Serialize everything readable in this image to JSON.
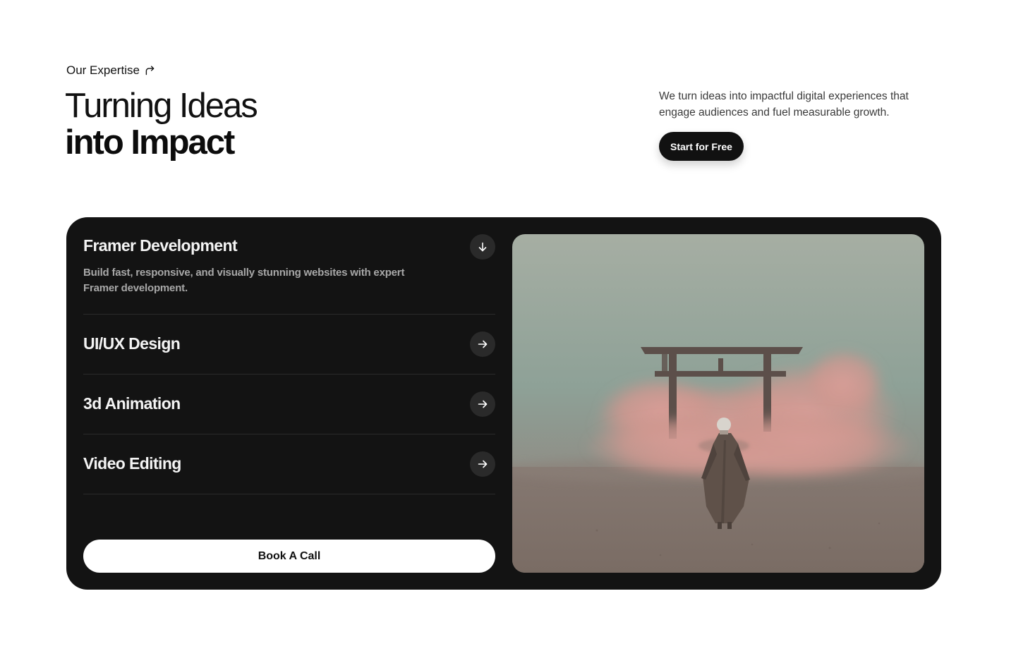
{
  "header": {
    "eyebrow": "Our Expertise",
    "headline_light": "Turning Ideas",
    "headline_bold": "into Impact",
    "intro": "We turn ideas into impactful digital experiences that engage audiences and fuel measurable growth.",
    "cta_label": "Start for Free"
  },
  "services": [
    {
      "title": "Framer Development",
      "description": "Build fast, responsive, and visually stunning websites with expert Framer development.",
      "expanded": true,
      "icon": "arrow-down-icon"
    },
    {
      "title": "UI/UX Design",
      "expanded": false,
      "icon": "arrow-right-icon"
    },
    {
      "title": "3d Animation",
      "expanded": false,
      "icon": "arrow-right-icon"
    },
    {
      "title": "Video Editing",
      "expanded": false,
      "icon": "arrow-right-icon"
    }
  ],
  "book_call_label": "Book A Call",
  "colors": {
    "card_background": "#131313",
    "icon_button_background": "#2a2a2a",
    "primary_button": "#111111",
    "accent_pink": "#d59c96"
  }
}
